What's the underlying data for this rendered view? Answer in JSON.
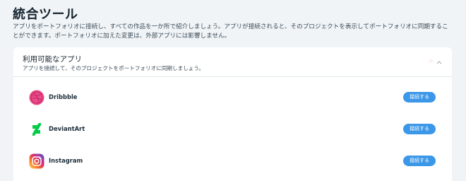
{
  "page": {
    "title": "統合ツール",
    "description": "アプリをポートフォリオに接続し、すべての作品を一か所で紹介しましょう。アプリが接続されると、そのプロジェクトを表示してポートフォリオに同期することができます。ポートフォリオに加えた変更は、外部アプリには影響しません。"
  },
  "panel": {
    "title": "利用可能なアプリ",
    "subtitle": "アプリを接続して、そのプロジェクトをポートフォリオに同期しましょう。",
    "collapse_icon": "chevron-up-icon"
  },
  "apps": [
    {
      "name": "Dribbble",
      "icon": "dribbble-icon",
      "button_label": "接続する",
      "color": "#ea4c89"
    },
    {
      "name": "DeviantArt",
      "icon": "deviantart-icon",
      "button_label": "接続する",
      "color": "#05cc47"
    },
    {
      "name": "Instagram",
      "icon": "instagram-icon",
      "button_label": "接続する",
      "color": "#e1306c"
    }
  ],
  "colors": {
    "background": "#f0f4f7",
    "card": "#ffffff",
    "accent": "#3b97e8"
  }
}
